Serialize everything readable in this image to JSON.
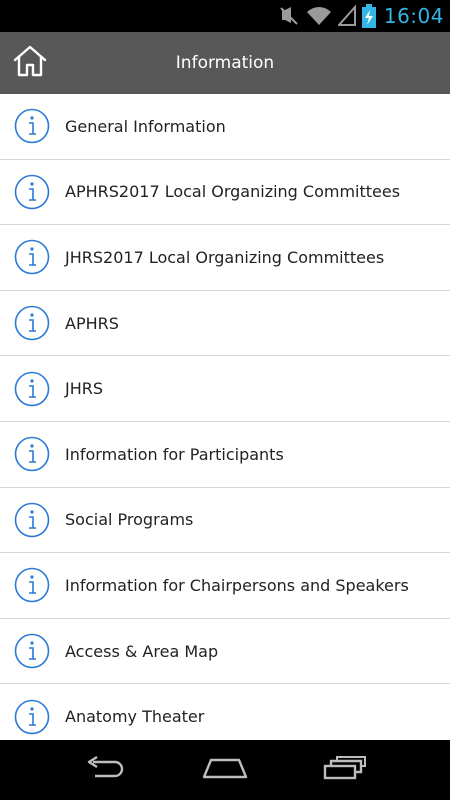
{
  "status_bar": {
    "time": "16:04",
    "icons": [
      "mute-icon",
      "wifi-icon",
      "signal-icon",
      "battery-charging-icon"
    ]
  },
  "action_bar": {
    "title": "Information",
    "home_icon": "home-icon"
  },
  "list": {
    "item_icon": "info-icon",
    "accent_color": "#2979d8",
    "items": [
      {
        "label": "General Information"
      },
      {
        "label": "APHRS2017 Local Organizing Committees"
      },
      {
        "label": "JHRS2017 Local Organizing Committees"
      },
      {
        "label": "APHRS"
      },
      {
        "label": "JHRS"
      },
      {
        "label": "Information for Participants"
      },
      {
        "label": "Social Programs"
      },
      {
        "label": "Information for Chairpersons and Speakers"
      },
      {
        "label": "Access & Area Map"
      },
      {
        "label": "Anatomy Theater"
      }
    ]
  },
  "nav_bar": {
    "buttons": [
      "back-icon",
      "home-icon",
      "recent-apps-icon"
    ]
  },
  "colors": {
    "status_clock": "#33b5e5",
    "action_bar_bg": "#585858",
    "list_bg": "#ffffff",
    "divider": "#d6d6d6"
  }
}
